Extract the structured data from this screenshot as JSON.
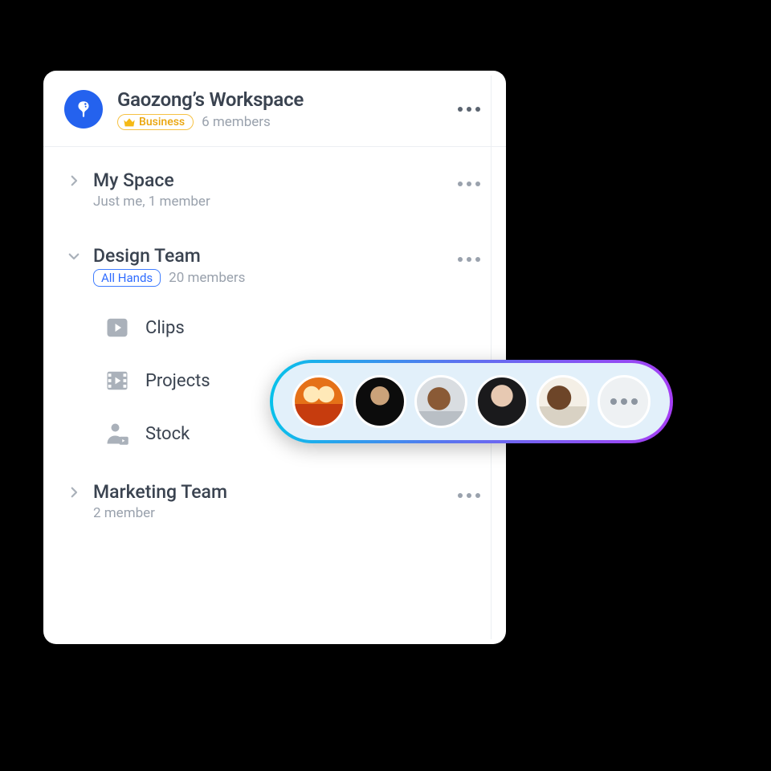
{
  "workspace": {
    "title": "Gaozong’s Workspace",
    "plan_label": "Business",
    "members_label": "6 members"
  },
  "spaces": [
    {
      "name": "My Space",
      "sub": "Just me, 1 member",
      "expanded": false
    },
    {
      "name": "Design Team",
      "tag": "All Hands",
      "members": "20 members",
      "expanded": true,
      "children": [
        {
          "label": "Clips"
        },
        {
          "label": "Projects"
        },
        {
          "label": "Stock"
        }
      ]
    },
    {
      "name": "Marketing Team",
      "sub": "2 member",
      "expanded": false
    }
  ],
  "member_pill": {
    "avatars": [
      "member-1",
      "member-2",
      "member-3",
      "member-4",
      "member-5"
    ],
    "more": true
  }
}
